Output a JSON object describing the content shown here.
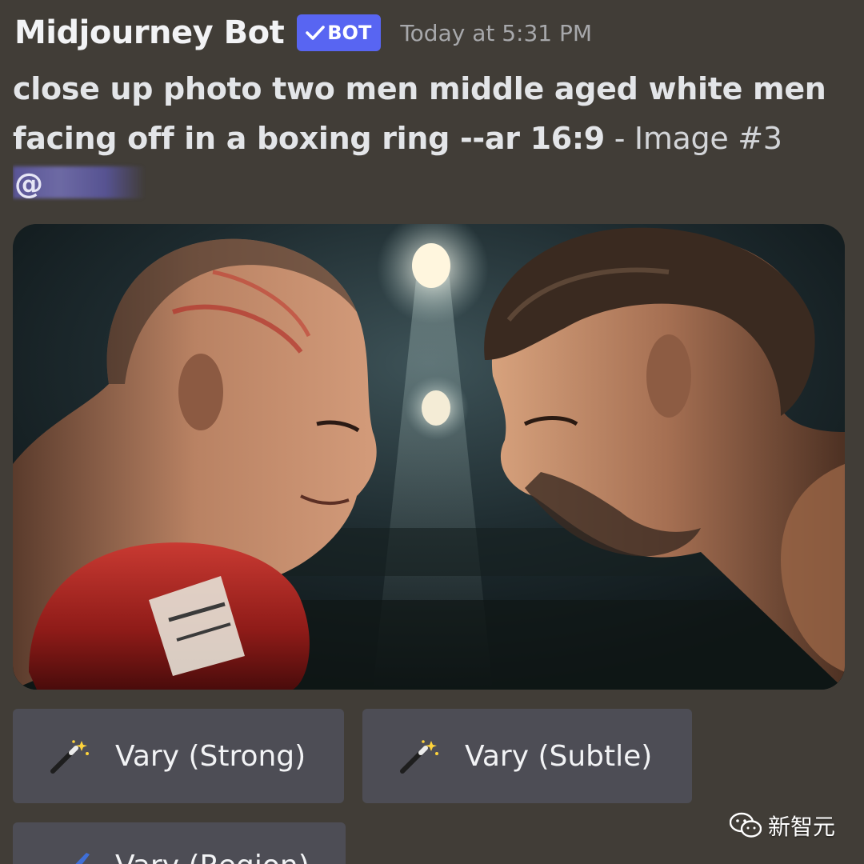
{
  "message": {
    "username": "Midjourney Bot",
    "badge": "BOT",
    "timestamp": "Today at 5:31 PM",
    "prompt_bold": "close up photo two men middle aged white men facing off in a boxing ring --ar 16:9",
    "prompt_suffix": " - Image #3",
    "mention_symbol": "@"
  },
  "image": {
    "alt": "close up photo two men middle aged white men facing off in a boxing ring"
  },
  "buttons": [
    {
      "label": "Vary (Strong)",
      "icon": "magic-wand-icon"
    },
    {
      "label": "Vary (Subtle)",
      "icon": "magic-wand-icon"
    },
    {
      "label": "Vary (Region)",
      "icon": "paintbrush-icon"
    }
  ],
  "watermark": {
    "text": "新智元",
    "icon": "wechat-icon"
  },
  "colors": {
    "background": "#413d37",
    "badge": "#5865f2",
    "button": "#4d4d55",
    "glove": "#a8201c"
  }
}
